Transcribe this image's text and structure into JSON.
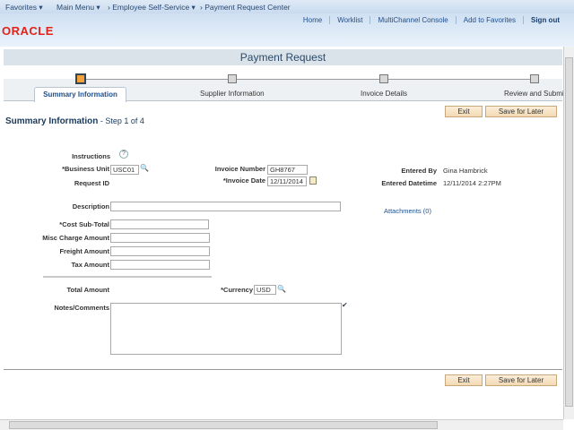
{
  "nav": {
    "favorites": "Favorites ▾",
    "main_menu": "Main Menu ▾",
    "crumb1": "› Employee Self-Service ▾",
    "crumb2": "› Payment Request Center"
  },
  "header": {
    "logo": "ORACLE",
    "links": [
      "Home",
      "Worklist",
      "MultiChannel Console",
      "Add to Favorites",
      "Sign out"
    ]
  },
  "page_title": "Payment Request",
  "steps": [
    {
      "label": "Summary Information",
      "active": true
    },
    {
      "label": "Supplier Information"
    },
    {
      "label": "Invoice Details"
    },
    {
      "label": "Review and Submit"
    }
  ],
  "buttons": {
    "exit": "Exit",
    "save": "Save for Later"
  },
  "section": {
    "title": "Summary Information",
    "step": " - Step 1 of 4"
  },
  "form": {
    "instructions": "Instructions",
    "business_unit_label": "*Business Unit",
    "business_unit": "USC01",
    "request_id_label": "Request ID",
    "invoice_number_label": "Invoice Number",
    "invoice_number": "GH8767",
    "invoice_date_label": "*Invoice Date",
    "invoice_date": "12/11/2014",
    "entered_by_label": "Entered By",
    "entered_by": "Gina Hambrick",
    "entered_dt_label": "Entered Datetime",
    "entered_dt": "12/11/2014  2:27PM",
    "description_label": "Description",
    "description": "",
    "attachments": "Attachments (0)",
    "cost_label": "*Cost Sub-Total",
    "misc_label": "Misc Charge Amount",
    "freight_label": "Freight Amount",
    "tax_label": "Tax Amount",
    "total_label": "Total Amount",
    "currency_label": "*Currency",
    "currency": "USD",
    "notes_label": "Notes/Comments"
  }
}
